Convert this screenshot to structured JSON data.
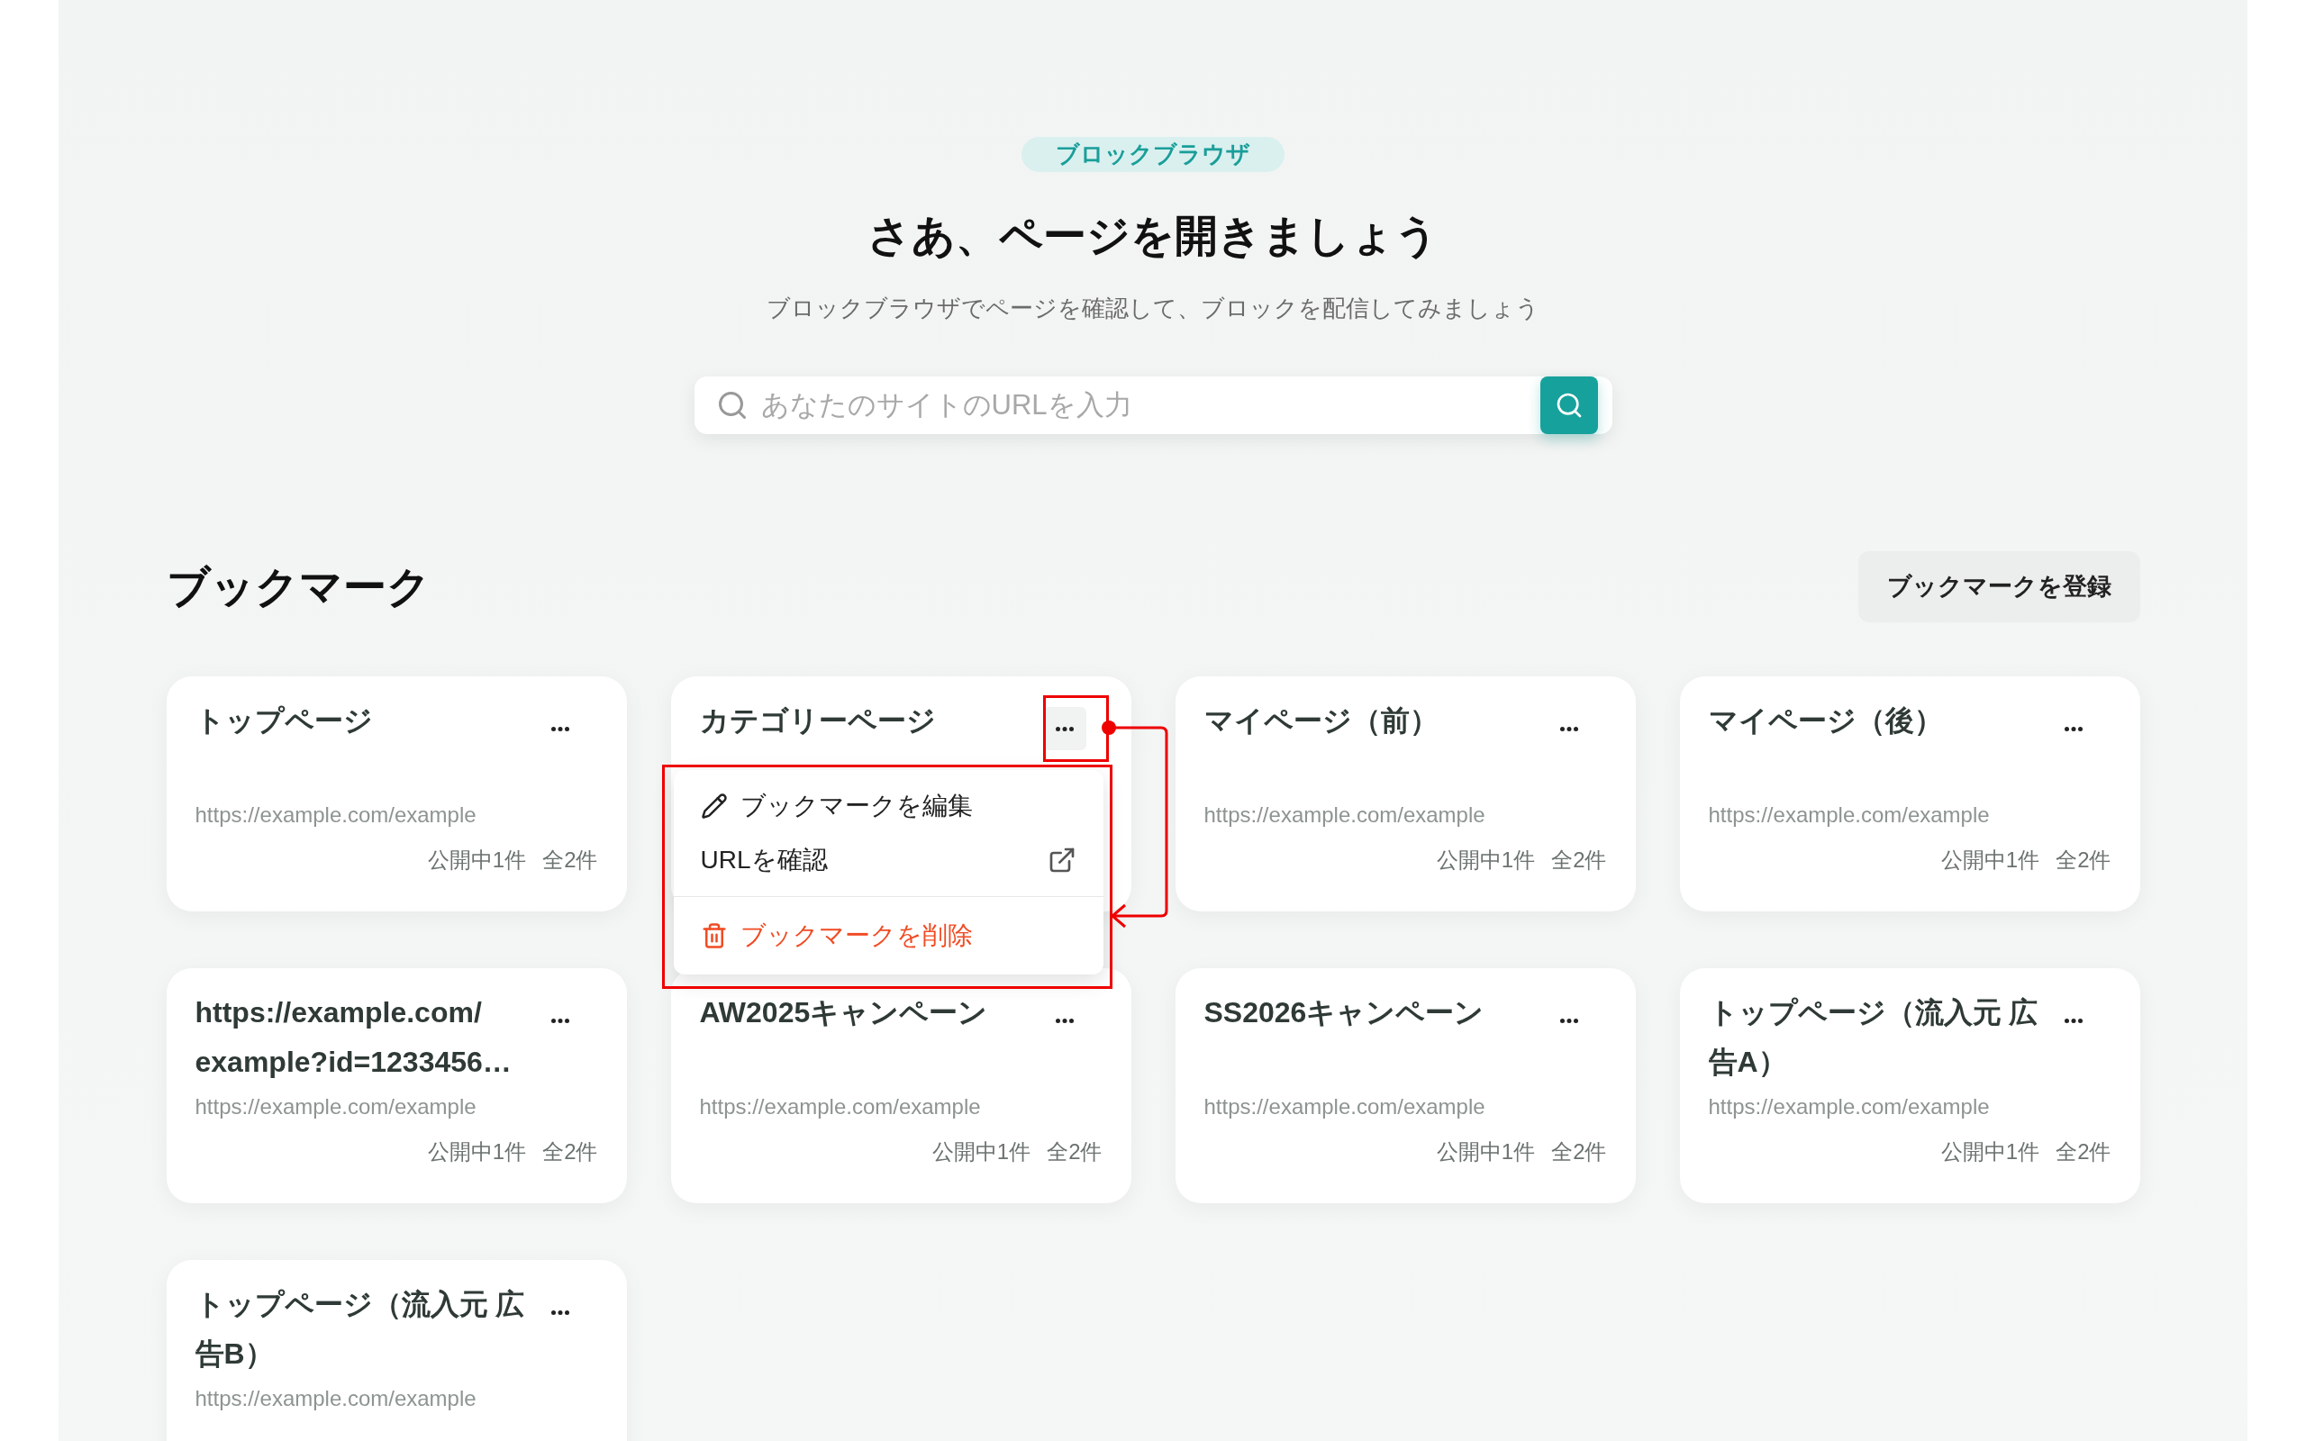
{
  "badge": "ブロックブラウザ",
  "title": "さあ、ページを開きましょう",
  "subtitle": "ブロックブラウザでページを確認して、ブロックを配信してみましょう",
  "search": {
    "placeholder": "あなたのサイトのURLを入力"
  },
  "bookmarks": {
    "heading": "ブックマーク",
    "register_button": "ブックマークを登録",
    "cards": [
      {
        "title": "トップページ",
        "url": "https://example.com/example",
        "published": "公開中1件",
        "total": "全2件",
        "menu_open": false
      },
      {
        "title": "カテゴリーページ",
        "menu_open": true
      },
      {
        "title": "マイページ（前）",
        "url": "https://example.com/example",
        "published": "公開中1件",
        "total": "全2件",
        "menu_open": false
      },
      {
        "title": "マイページ（後）",
        "url": "https://example.com/example",
        "published": "公開中1件",
        "total": "全2件",
        "menu_open": false
      },
      {
        "title": "https://example.com/\nexample?id=1233456…",
        "url": "https://example.com/example",
        "published": "公開中1件",
        "total": "全2件",
        "menu_open": false
      },
      {
        "title": "AW2025キャンペーン",
        "url": "https://example.com/example",
        "published": "公開中1件",
        "total": "全2件",
        "menu_open": false
      },
      {
        "title": "SS2026キャンペーン",
        "url": "https://example.com/example",
        "published": "公開中1件",
        "total": "全2件",
        "menu_open": false
      },
      {
        "title": "トップページ（流入元 広告A）",
        "url": "https://example.com/example",
        "published": "公開中1件",
        "total": "全2件",
        "menu_open": false
      },
      {
        "title": "トップページ（流入元 広告B）",
        "url": "https://example.com/example",
        "menu_open": false
      }
    ]
  },
  "menu": {
    "items": [
      {
        "kind": "edit",
        "label": "ブックマークを編集"
      },
      {
        "kind": "open",
        "label": "URLを確認"
      },
      {
        "kind": "delete",
        "label": "ブックマークを削除"
      }
    ]
  }
}
